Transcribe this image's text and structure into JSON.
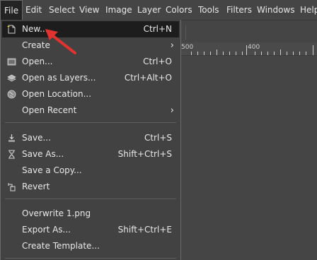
{
  "menubar": {
    "items": [
      {
        "label": "File",
        "active": true
      },
      {
        "label": "Edit"
      },
      {
        "label": "Select"
      },
      {
        "label": "View"
      },
      {
        "label": "Image"
      },
      {
        "label": "Layer"
      },
      {
        "label": "Colors"
      },
      {
        "label": "Tools"
      },
      {
        "label": "Filters"
      },
      {
        "label": "Windows"
      },
      {
        "label": "Help"
      }
    ]
  },
  "ruler": {
    "labels": [
      "500",
      "400"
    ]
  },
  "file_menu": {
    "items": [
      {
        "label": "New...",
        "shortcut": "Ctrl+N",
        "icon": "new-document-icon"
      },
      {
        "label": "Create",
        "submenu": true
      },
      {
        "label": "Open...",
        "shortcut": "Ctrl+O",
        "icon": "open-icon"
      },
      {
        "label": "Open as Layers...",
        "shortcut": "Ctrl+Alt+O",
        "icon": "open-layers-icon"
      },
      {
        "label": "Open Location...",
        "icon": "globe-icon"
      },
      {
        "label": "Open Recent",
        "submenu": true
      },
      {
        "label": "Save...",
        "shortcut": "Ctrl+S",
        "icon": "save-icon"
      },
      {
        "label": "Save As...",
        "shortcut": "Shift+Ctrl+S",
        "icon": "save-as-icon"
      },
      {
        "label": "Save a Copy..."
      },
      {
        "label": "Revert",
        "icon": "revert-icon"
      },
      {
        "label": "Overwrite 1.png"
      },
      {
        "label": "Export As...",
        "shortcut": "Shift+Ctrl+E"
      },
      {
        "label": "Create Template..."
      }
    ],
    "submenu_arrow": "›"
  },
  "colors": {
    "annotation_arrow": "#e0322e",
    "highlight": "#1d1d1d",
    "menu_bg": "#424242"
  }
}
